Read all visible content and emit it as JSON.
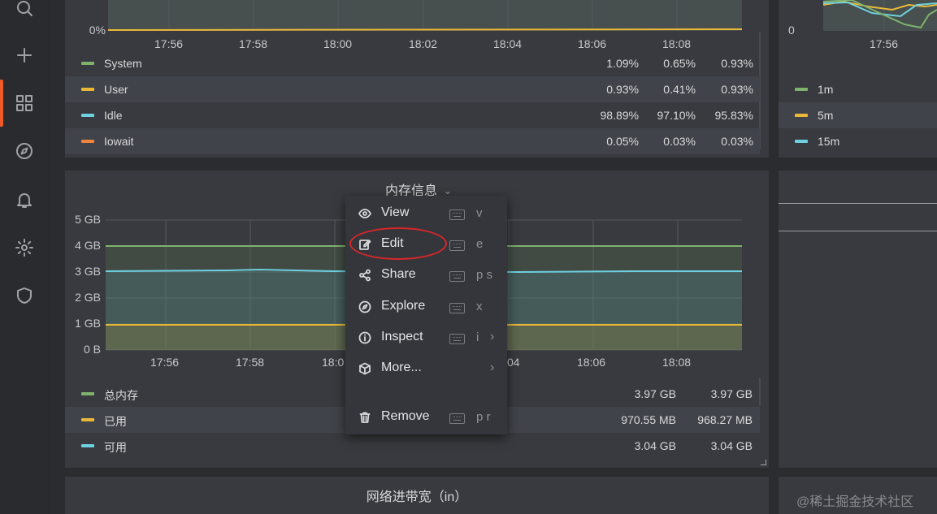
{
  "sidebar": {
    "items": [
      {
        "icon": "search-icon"
      },
      {
        "icon": "plus-icon"
      },
      {
        "icon": "dashboards-icon"
      },
      {
        "icon": "compass-icon"
      },
      {
        "icon": "bell-icon"
      },
      {
        "icon": "gear-icon"
      },
      {
        "icon": "shield-icon"
      }
    ],
    "active_color": "#f05a28"
  },
  "cpu_panel": {
    "y_min_label": "0%",
    "x_ticks": [
      "17:56",
      "17:58",
      "18:00",
      "18:02",
      "18:04",
      "18:06",
      "18:08"
    ],
    "legend": [
      {
        "name": "System",
        "color": "#7eb26d",
        "v1": "1.09%",
        "v2": "0.65%",
        "v3": "0.93%"
      },
      {
        "name": "User",
        "color": "#eab839",
        "v1": "0.93%",
        "v2": "0.41%",
        "v3": "0.93%"
      },
      {
        "name": "Idle",
        "color": "#6ed0e0",
        "v1": "98.89%",
        "v2": "97.10%",
        "v3": "95.83%"
      },
      {
        "name": "Iowait",
        "color": "#ef843c",
        "v1": "0.05%",
        "v2": "0.03%",
        "v3": "0.03%"
      }
    ]
  },
  "load_panel": {
    "y_min_label": "0",
    "x_tick": "17:56",
    "legend": [
      {
        "name": "1m",
        "color": "#7eb26d"
      },
      {
        "name": "5m",
        "color": "#eab839"
      },
      {
        "name": "15m",
        "color": "#6ed0e0"
      }
    ]
  },
  "memory_panel": {
    "title": "内存信息",
    "y_labels": [
      "5 GB",
      "4 GB",
      "3 GB",
      "2 GB",
      "1 GB",
      "0 B"
    ],
    "x_ticks": [
      "17:56",
      "17:58",
      "18:0",
      "04",
      "18:06",
      "18:08"
    ],
    "legend": [
      {
        "name": "总内存",
        "color": "#7eb26d",
        "v2": "3.97 GB",
        "v3": "3.97 GB"
      },
      {
        "name": "已用",
        "color": "#eab839",
        "v2": "970.55 MB",
        "v3": "968.27 MB"
      },
      {
        "name": "可用",
        "color": "#6ed0e0",
        "v2": "3.04 GB",
        "v3": "3.04 GB"
      }
    ]
  },
  "network_panel": {
    "title": "网络进带宽（in）"
  },
  "context_menu": {
    "items": [
      {
        "label": "View",
        "key": "v",
        "icon": "eye-icon"
      },
      {
        "label": "Edit",
        "key": "e",
        "icon": "edit-icon"
      },
      {
        "label": "Share",
        "key": "p s",
        "icon": "share-icon"
      },
      {
        "label": "Explore",
        "key": "x",
        "icon": "compass-icon"
      },
      {
        "label": "Inspect",
        "key": "i",
        "icon": "info-icon"
      },
      {
        "label": "More...",
        "key": "",
        "icon": "cube-icon"
      },
      {
        "label": "Remove",
        "key": "p r",
        "icon": "trash-icon"
      }
    ]
  },
  "watermark": "@稀土掘金技术社区"
}
